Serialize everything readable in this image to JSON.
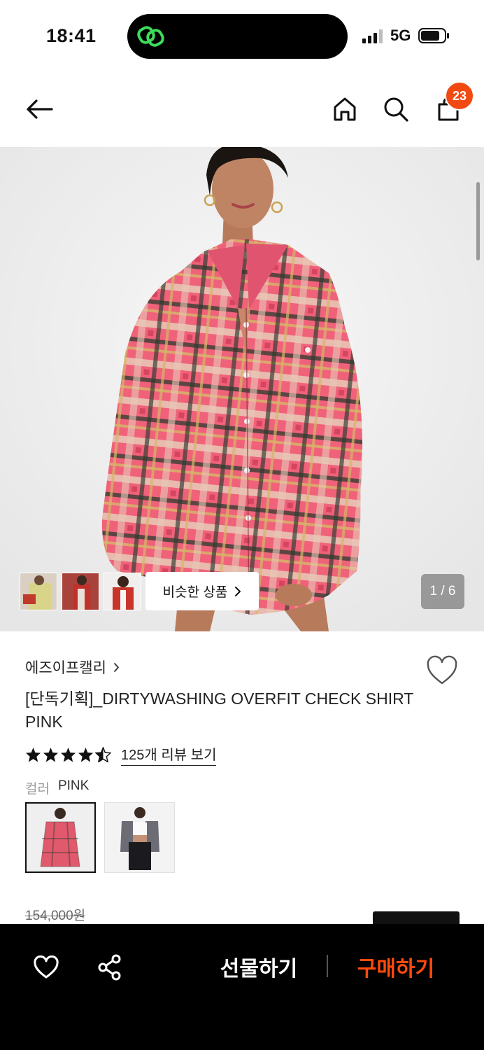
{
  "status_bar": {
    "time": "18:41",
    "network": "5G",
    "icons": [
      "app-link-icon",
      "signal-icon",
      "battery-icon"
    ]
  },
  "nav": {
    "icons": [
      "back-arrow-icon",
      "home-icon",
      "search-icon",
      "cart-bag-icon"
    ],
    "cart_count": "23"
  },
  "hero": {
    "page_indicator": "1 / 6",
    "similar_button_label": "비슷한 상품",
    "similar_button_icon": "chevron-right-icon",
    "mini_thumbnails": 3
  },
  "product": {
    "brand": "에즈이프캘리",
    "title": "[단독기획]_DIRTYWASHING OVERFIT CHECK SHIRT PINK",
    "rating": 4.5,
    "review_link": "125개 리뷰 보기",
    "color_label": "컬러",
    "color_value": "PINK",
    "swatches": [
      {
        "name": "PINK",
        "selected": true
      },
      {
        "name": "GREY",
        "selected": false
      }
    ],
    "original_price": "154,000원",
    "wishlist_icon": "heart-outline-icon"
  },
  "bottom_bar": {
    "icons": [
      "heart-outline-icon",
      "share-icon"
    ],
    "gift_label": "선물하기",
    "buy_label": "구매하기",
    "colors": {
      "background": "#000000",
      "buy": "#ff4a0d",
      "gift": "#ffffff"
    }
  },
  "colors": {
    "accent": "#f04a12",
    "text": "#222222",
    "muted": "#9a9a9a"
  }
}
